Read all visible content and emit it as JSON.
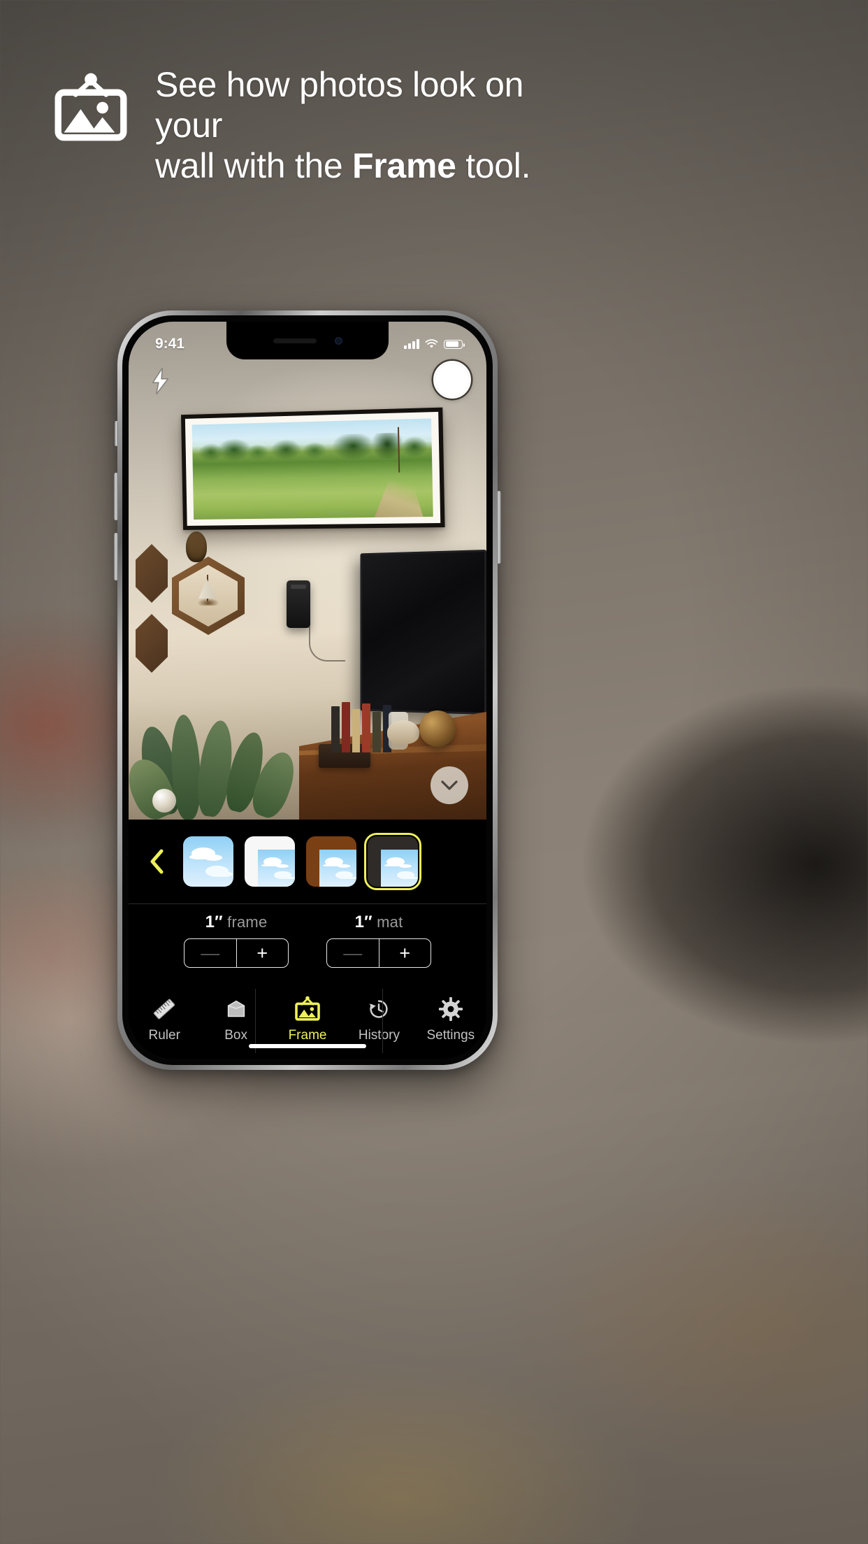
{
  "marketing": {
    "headline_line1": "See how photos look on your",
    "headline_line2_pre": "wall with the ",
    "headline_line2_bold": "Frame",
    "headline_line2_post": " tool.",
    "logo_icon": "framed-picture-icon"
  },
  "phone": {
    "status_bar": {
      "time": "9:41",
      "cellular_icon": "signal-bars-icon",
      "wifi_icon": "wifi-icon",
      "battery_icon": "battery-icon"
    }
  },
  "camera": {
    "flash_icon": "flash-bolt-icon",
    "shutter_icon": "shutter-button-icon",
    "collapse_icon": "chevron-down-icon",
    "scene_description": "Living room wall with virtual framed panorama photo"
  },
  "style_picker": {
    "back_icon": "chevron-left-icon",
    "back_color": "#eef05a",
    "selected_index": 3,
    "selected_color": "#eef05a",
    "thumbnails": [
      {
        "name": "no-frame",
        "frame_color": "none",
        "label": "No frame"
      },
      {
        "name": "white-mat",
        "frame_color": "#f7f7f7",
        "label": "White"
      },
      {
        "name": "brown-frame",
        "frame_color": "#7a3f12",
        "label": "Brown"
      },
      {
        "name": "dark-frame",
        "frame_color": "#2e2b28",
        "label": "Dark"
      }
    ]
  },
  "adjust": {
    "frame": {
      "value": "1″",
      "label": " frame",
      "minus_label": "—",
      "plus_label": "+"
    },
    "mat": {
      "value": "1″",
      "label": " mat",
      "minus_label": "—",
      "plus_label": "+"
    }
  },
  "tabbar": {
    "active_index": 2,
    "active_color": "#eef05a",
    "tabs": [
      {
        "label": "Ruler",
        "icon": "ruler-icon"
      },
      {
        "label": "Box",
        "icon": "box-icon"
      },
      {
        "label": "Frame",
        "icon": "framed-picture-icon"
      },
      {
        "label": "History",
        "icon": "clock-history-icon"
      },
      {
        "label": "Settings",
        "icon": "gear-icon"
      }
    ]
  }
}
